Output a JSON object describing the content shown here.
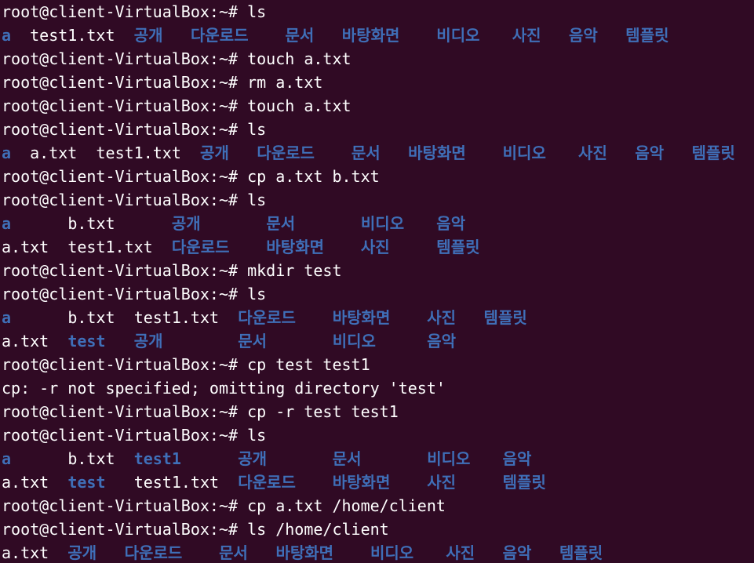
{
  "prompt": "root@client-VirtualBox:~#",
  "lines": [
    {
      "type": "prompt",
      "command": "ls"
    },
    {
      "type": "listing",
      "items": [
        {
          "text": "a",
          "kind": "dir",
          "col": 0
        },
        {
          "text": "test1.txt",
          "kind": "file",
          "col": 3
        },
        {
          "text": "공개",
          "kind": "dir",
          "col": 14
        },
        {
          "text": "다운로드",
          "kind": "dir",
          "col": 20
        },
        {
          "text": "문서",
          "kind": "dir",
          "col": 30
        },
        {
          "text": "바탕화면",
          "kind": "dir",
          "col": 36
        },
        {
          "text": "비디오",
          "kind": "dir",
          "col": 46
        },
        {
          "text": "사진",
          "kind": "dir",
          "col": 54
        },
        {
          "text": "음악",
          "kind": "dir",
          "col": 60
        },
        {
          "text": "템플릿",
          "kind": "dir",
          "col": 66
        }
      ]
    },
    {
      "type": "prompt",
      "command": "touch a.txt"
    },
    {
      "type": "prompt",
      "command": "rm a.txt"
    },
    {
      "type": "prompt",
      "command": "touch a.txt"
    },
    {
      "type": "prompt",
      "command": "ls"
    },
    {
      "type": "listing",
      "items": [
        {
          "text": "a",
          "kind": "dir",
          "col": 0
        },
        {
          "text": "a.txt",
          "kind": "file",
          "col": 3
        },
        {
          "text": "test1.txt",
          "kind": "file",
          "col": 10
        },
        {
          "text": "공개",
          "kind": "dir",
          "col": 21
        },
        {
          "text": "다운로드",
          "kind": "dir",
          "col": 27
        },
        {
          "text": "문서",
          "kind": "dir",
          "col": 37
        },
        {
          "text": "바탕화면",
          "kind": "dir",
          "col": 43
        },
        {
          "text": "비디오",
          "kind": "dir",
          "col": 53
        },
        {
          "text": "사진",
          "kind": "dir",
          "col": 61
        },
        {
          "text": "음악",
          "kind": "dir",
          "col": 67
        },
        {
          "text": "템플릿",
          "kind": "dir",
          "col": 73
        }
      ]
    },
    {
      "type": "prompt",
      "command": "cp a.txt b.txt"
    },
    {
      "type": "prompt",
      "command": "ls"
    },
    {
      "type": "listing",
      "items": [
        {
          "text": "a",
          "kind": "dir",
          "col": 0
        },
        {
          "text": "b.txt",
          "kind": "file",
          "col": 7
        },
        {
          "text": "공개",
          "kind": "dir",
          "col": 18
        },
        {
          "text": "문서",
          "kind": "dir",
          "col": 28
        },
        {
          "text": "비디오",
          "kind": "dir",
          "col": 38
        },
        {
          "text": "음악",
          "kind": "dir",
          "col": 46
        }
      ]
    },
    {
      "type": "listing",
      "items": [
        {
          "text": "a.txt",
          "kind": "file",
          "col": 0
        },
        {
          "text": "test1.txt",
          "kind": "file",
          "col": 7
        },
        {
          "text": "다운로드",
          "kind": "dir",
          "col": 18
        },
        {
          "text": "바탕화면",
          "kind": "dir",
          "col": 28
        },
        {
          "text": "사진",
          "kind": "dir",
          "col": 38
        },
        {
          "text": "템플릿",
          "kind": "dir",
          "col": 46
        }
      ]
    },
    {
      "type": "prompt",
      "command": "mkdir test"
    },
    {
      "type": "prompt",
      "command": "ls"
    },
    {
      "type": "listing",
      "items": [
        {
          "text": "a",
          "kind": "dir",
          "col": 0
        },
        {
          "text": "b.txt",
          "kind": "file",
          "col": 7
        },
        {
          "text": "test1.txt",
          "kind": "file",
          "col": 14
        },
        {
          "text": "다운로드",
          "kind": "dir",
          "col": 25
        },
        {
          "text": "바탕화면",
          "kind": "dir",
          "col": 35
        },
        {
          "text": "사진",
          "kind": "dir",
          "col": 45
        },
        {
          "text": "템플릿",
          "kind": "dir",
          "col": 51
        }
      ]
    },
    {
      "type": "listing",
      "items": [
        {
          "text": "a.txt",
          "kind": "file",
          "col": 0
        },
        {
          "text": "test",
          "kind": "dir",
          "col": 7
        },
        {
          "text": "공개",
          "kind": "dir",
          "col": 14
        },
        {
          "text": "문서",
          "kind": "dir",
          "col": 25
        },
        {
          "text": "비디오",
          "kind": "dir",
          "col": 35
        },
        {
          "text": "음악",
          "kind": "dir",
          "col": 45
        }
      ]
    },
    {
      "type": "prompt",
      "command": "cp test test1"
    },
    {
      "type": "output",
      "text": "cp: -r not specified; omitting directory 'test'"
    },
    {
      "type": "prompt",
      "command": "cp -r test test1"
    },
    {
      "type": "prompt",
      "command": "ls"
    },
    {
      "type": "listing",
      "items": [
        {
          "text": "a",
          "kind": "dir",
          "col": 0
        },
        {
          "text": "b.txt",
          "kind": "file",
          "col": 7
        },
        {
          "text": "test1",
          "kind": "dir",
          "col": 14
        },
        {
          "text": "공개",
          "kind": "dir",
          "col": 25
        },
        {
          "text": "문서",
          "kind": "dir",
          "col": 35
        },
        {
          "text": "비디오",
          "kind": "dir",
          "col": 45
        },
        {
          "text": "음악",
          "kind": "dir",
          "col": 53
        }
      ]
    },
    {
      "type": "listing",
      "items": [
        {
          "text": "a.txt",
          "kind": "file",
          "col": 0
        },
        {
          "text": "test",
          "kind": "dir",
          "col": 7
        },
        {
          "text": "test1.txt",
          "kind": "file",
          "col": 14
        },
        {
          "text": "다운로드",
          "kind": "dir",
          "col": 25
        },
        {
          "text": "바탕화면",
          "kind": "dir",
          "col": 35
        },
        {
          "text": "사진",
          "kind": "dir",
          "col": 45
        },
        {
          "text": "템플릿",
          "kind": "dir",
          "col": 53
        }
      ]
    },
    {
      "type": "prompt",
      "command": "cp a.txt /home/client"
    },
    {
      "type": "prompt",
      "command": "ls /home/client"
    },
    {
      "type": "listing",
      "items": [
        {
          "text": "a.txt",
          "kind": "file",
          "col": 0
        },
        {
          "text": "공개",
          "kind": "dir",
          "col": 7
        },
        {
          "text": "다운로드",
          "kind": "dir",
          "col": 13
        },
        {
          "text": "문서",
          "kind": "dir",
          "col": 23
        },
        {
          "text": "바탕화면",
          "kind": "dir",
          "col": 29
        },
        {
          "text": "비디오",
          "kind": "dir",
          "col": 39
        },
        {
          "text": "사진",
          "kind": "dir",
          "col": 47
        },
        {
          "text": "음악",
          "kind": "dir",
          "col": 53
        },
        {
          "text": "템플릿",
          "kind": "dir",
          "col": 59
        }
      ]
    }
  ],
  "colors": {
    "background": "#300a24",
    "text": "#ffffff",
    "directory": "#3f6fb8"
  }
}
